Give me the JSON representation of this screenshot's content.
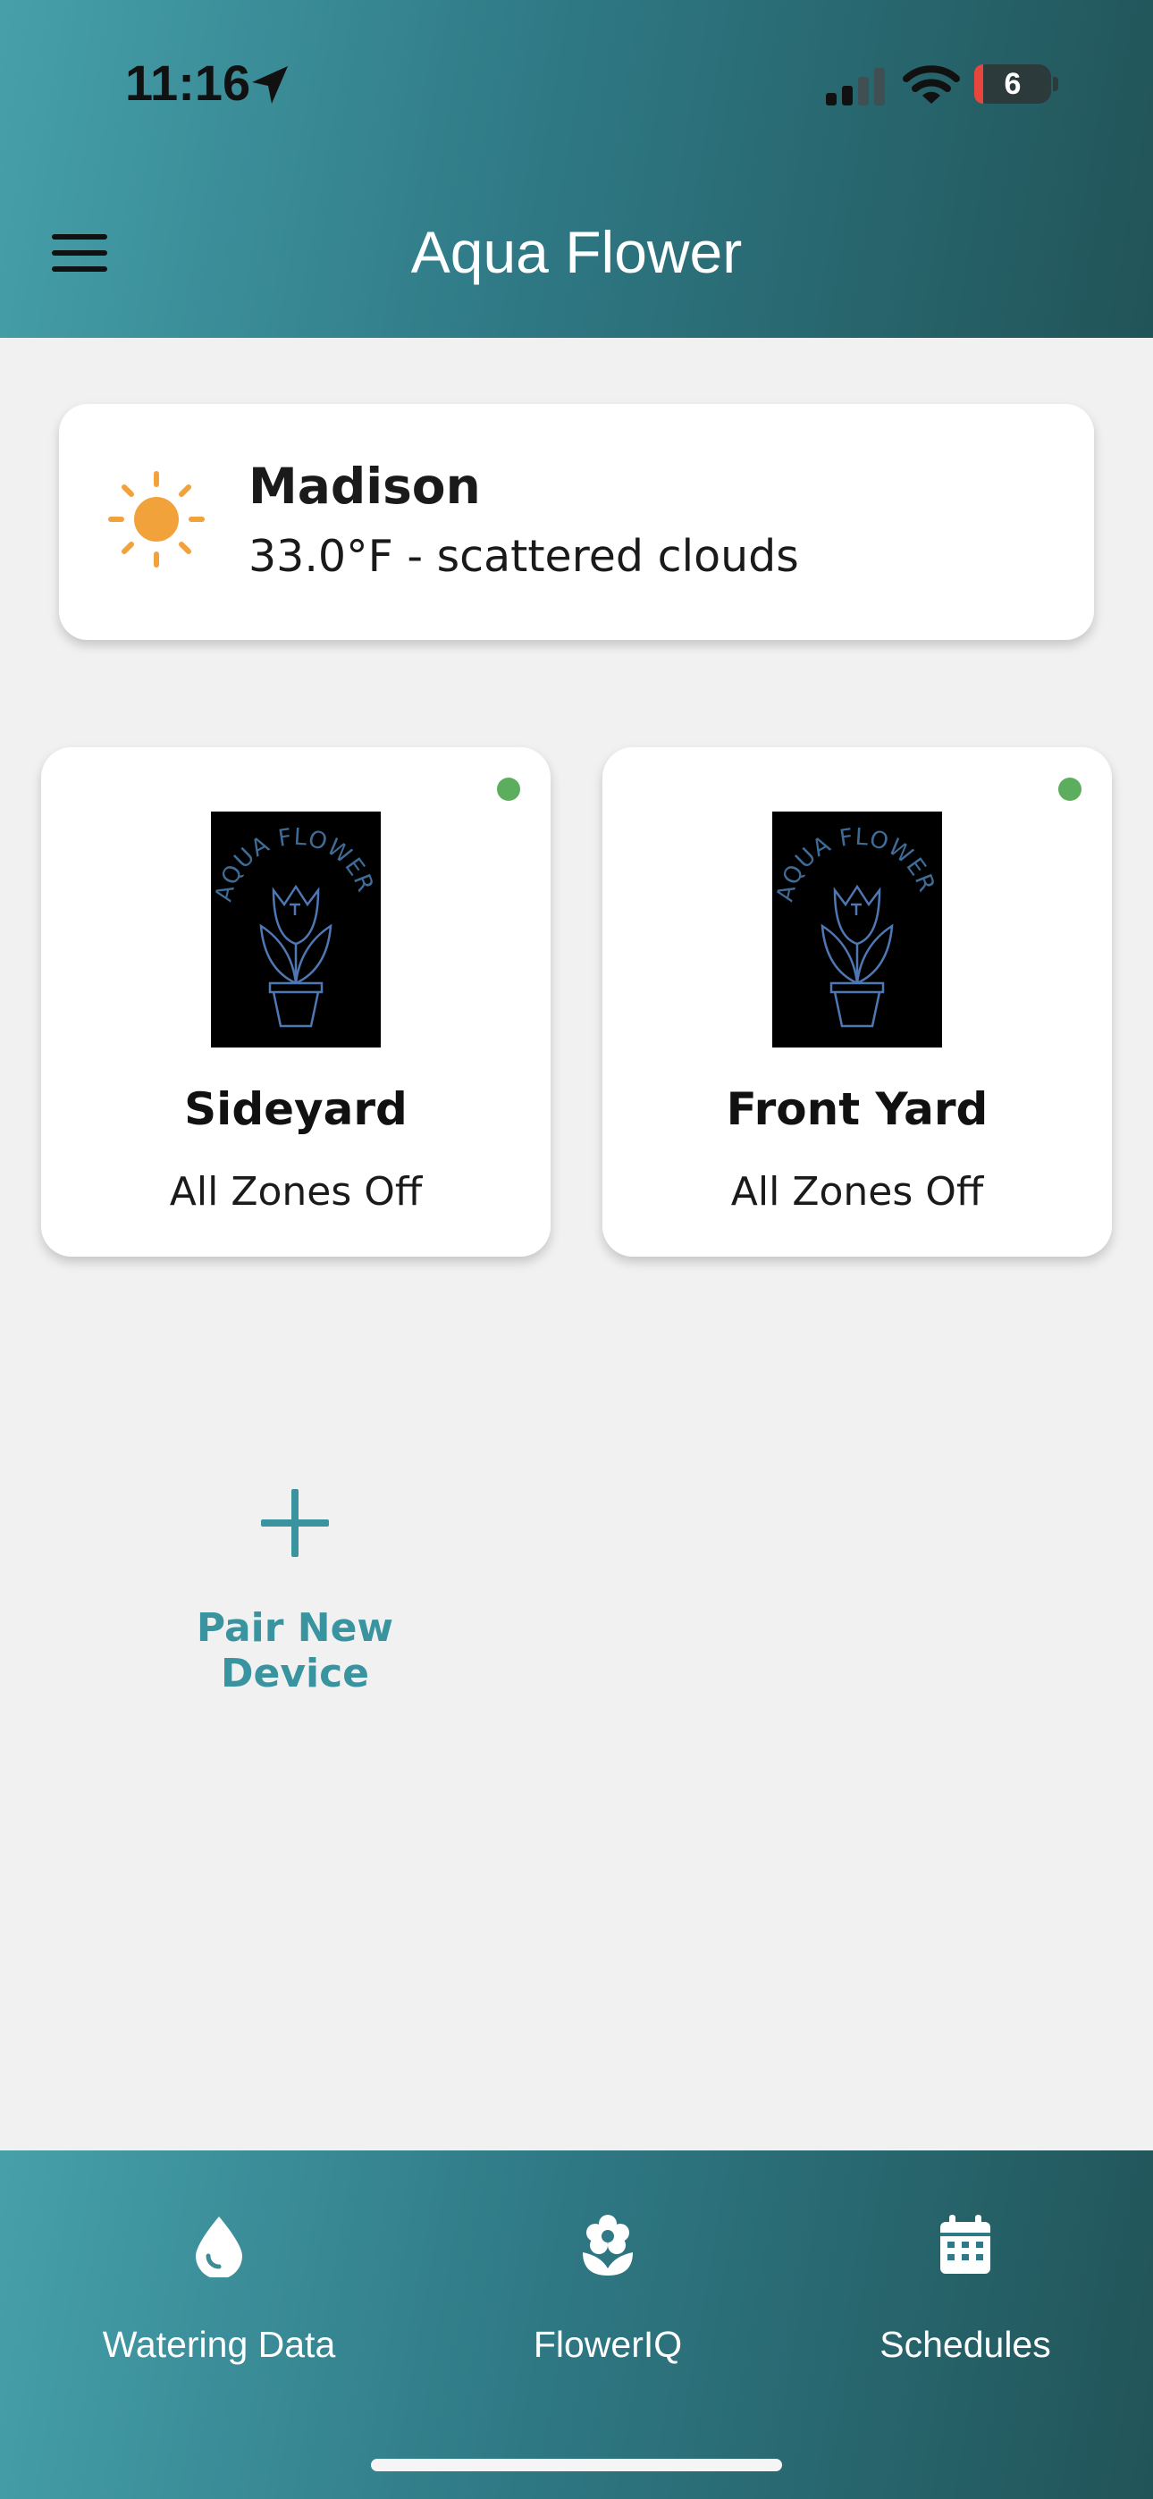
{
  "status_bar": {
    "time": "11:16",
    "battery_level": "6",
    "icons": [
      "location-arrow-icon",
      "cellular-signal-icon",
      "wifi-icon",
      "battery-icon"
    ]
  },
  "header": {
    "title": "Aqua Flower",
    "menu_icon": "hamburger-menu-icon"
  },
  "weather": {
    "city": "Madison",
    "description": "33.0°F - scattered clouds",
    "icon": "sun-icon"
  },
  "devices": [
    {
      "name": "Sideyard",
      "status": "All Zones Off",
      "online": true,
      "logo_text": "AQUA FLOWER"
    },
    {
      "name": "Front Yard",
      "status": "All Zones Off",
      "online": true,
      "logo_text": "AQUA FLOWER"
    }
  ],
  "pair": {
    "label": "Pair New Device",
    "icon": "plus-icon"
  },
  "bottom_nav": [
    {
      "label": "Watering Data",
      "icon": "water-drop-icon"
    },
    {
      "label": "FlowerIQ",
      "icon": "flower-icon"
    },
    {
      "label": "Schedules",
      "icon": "calendar-icon"
    }
  ],
  "colors": {
    "header_gradient_start": "#46a0aa",
    "header_gradient_end": "#215458",
    "accent": "#3a94a0",
    "online_dot": "#5cae5e",
    "sun": "#f2a23a",
    "background": "#f1f1f1"
  }
}
